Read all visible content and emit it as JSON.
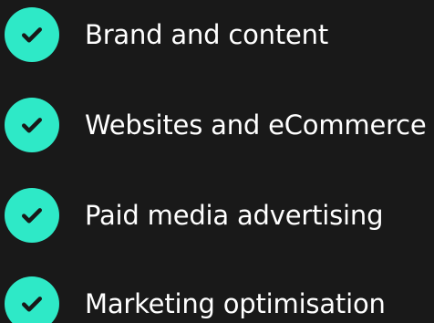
{
  "colors": {
    "background": "#191919",
    "accent": "#2ee9c7",
    "check_mark": "#191919",
    "text": "#ffffff"
  },
  "features": {
    "items": [
      {
        "icon": "check-circle-icon",
        "label": "Brand and content"
      },
      {
        "icon": "check-circle-icon",
        "label": "Websites and eCommerce"
      },
      {
        "icon": "check-circle-icon",
        "label": "Paid media advertising"
      },
      {
        "icon": "check-circle-icon",
        "label": "Marketing optimisation"
      }
    ]
  }
}
